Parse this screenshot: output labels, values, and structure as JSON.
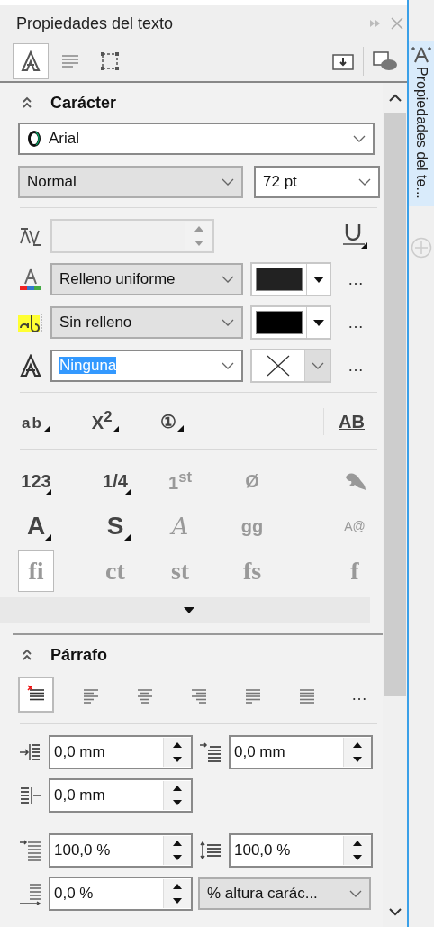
{
  "panel": {
    "title": "Propiedades del texto"
  },
  "toolbar": [
    {
      "kind": "character",
      "selected": true
    },
    {
      "kind": "paragraph",
      "selected": false
    },
    {
      "kind": "frame",
      "selected": false
    }
  ],
  "side_tab": {
    "label": "Propiedades del te...",
    "selected": true
  },
  "character": {
    "title": "Carácter",
    "expanded": true,
    "font": "Arial",
    "style": "Normal",
    "size": "72 pt",
    "fill": {
      "value": "Relleno uniforme",
      "color": "#222222",
      "more": "…"
    },
    "background": {
      "value": "Sin relleno",
      "color": "#000000",
      "more": "…"
    },
    "outline": {
      "value": "Ninguna",
      "selected": true,
      "more": "…"
    },
    "position_buttons": [
      {
        "label": "ab",
        "menu": true
      },
      {
        "label": "X$^{2}$",
        "menu": true
      },
      {
        "label": "①",
        "menu": true
      },
      {
        "label": "AB",
        "menu": false
      }
    ],
    "features": [
      {
        "kind": "text",
        "label": "123",
        "menu": true,
        "enabled": true,
        "selected": false
      },
      {
        "kind": "text",
        "label": "1/4",
        "menu": true,
        "enabled": true,
        "selected": false
      },
      {
        "kind": "text",
        "label": "1$^{st}$",
        "menu": false,
        "enabled": false,
        "selected": false
      },
      {
        "kind": "text",
        "label": "Ø",
        "menu": false,
        "enabled": false,
        "selected": false
      },
      {
        "kind": "swash",
        "menu": false,
        "enabled": false,
        "selected": false
      },
      {
        "kind": "text",
        "label": "A",
        "menu": true,
        "enabled": true,
        "selected": false
      },
      {
        "kind": "text",
        "label": "S",
        "menu": true,
        "enabled": true,
        "selected": false
      },
      {
        "kind": "script",
        "label": "A",
        "menu": false,
        "enabled": false,
        "selected": false
      },
      {
        "kind": "text",
        "label": "gg",
        "menu": false,
        "enabled": false,
        "selected": false
      },
      {
        "kind": "small",
        "label": "A@",
        "menu": false,
        "enabled": false,
        "selected": false
      },
      {
        "kind": "serif",
        "label": "fi",
        "menu": false,
        "enabled": false,
        "selected": true
      },
      {
        "kind": "serif",
        "label": "ct",
        "menu": false,
        "enabled": false,
        "selected": false
      },
      {
        "kind": "serif",
        "label": "st",
        "menu": false,
        "enabled": false,
        "selected": false
      },
      {
        "kind": "serif",
        "label": "fs",
        "menu": false,
        "enabled": false,
        "selected": false
      },
      {
        "kind": "serif",
        "label": "f",
        "menu": false,
        "enabled": false,
        "selected": false
      }
    ]
  },
  "paragraph": {
    "title": "Párrafo",
    "expanded": true,
    "alignments": [
      {
        "kind": "none",
        "selected": true
      },
      {
        "kind": "left",
        "selected": false
      },
      {
        "kind": "center",
        "selected": false
      },
      {
        "kind": "right",
        "selected": false
      },
      {
        "kind": "justify",
        "selected": false
      },
      {
        "kind": "force",
        "selected": false
      }
    ],
    "alignment_more": "…",
    "first_line_indent": "0,0 mm",
    "left_indent": "0,0 mm",
    "right_indent": "0,0 mm",
    "paragraph_spacing": "100,0 %",
    "line_spacing": "100,0 %",
    "character_spacing": "0,0 %",
    "spacing_unit": "% altura carác..."
  }
}
